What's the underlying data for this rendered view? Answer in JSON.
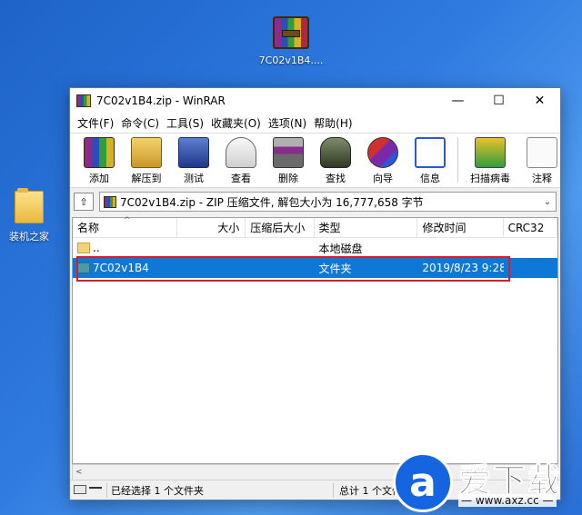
{
  "desktop": {
    "icons": [
      {
        "label": "7C02v1B4...."
      },
      {
        "label": "装机之家"
      }
    ]
  },
  "window": {
    "title": "7C02v1B4.zip - WinRAR",
    "controls": {
      "minimize": "—",
      "maximize": "☐",
      "close": "✕"
    }
  },
  "menu": [
    "文件(F)",
    "命令(C)",
    "工具(S)",
    "收藏夹(O)",
    "选项(N)",
    "帮助(H)"
  ],
  "toolbar": [
    {
      "label": "添加",
      "icon": "add-archive-icon"
    },
    {
      "label": "解压到",
      "icon": "extract-to-icon"
    },
    {
      "label": "测试",
      "icon": "test-icon"
    },
    {
      "label": "查看",
      "icon": "view-icon"
    },
    {
      "label": "删除",
      "icon": "delete-icon"
    },
    {
      "label": "查找",
      "icon": "find-icon"
    },
    {
      "label": "向导",
      "icon": "wizard-icon"
    },
    {
      "label": "信息",
      "icon": "info-icon"
    },
    {
      "label": "扫描病毒",
      "icon": "virus-scan-icon"
    },
    {
      "label": "注释",
      "icon": "comment-icon"
    }
  ],
  "address": {
    "text": "7C02v1B4.zip - ZIP 压缩文件, 解包大小为 16,777,658 字节",
    "up": "⇧",
    "dropdown": "⌄"
  },
  "columns": [
    "名称",
    "大小",
    "压缩后大小",
    "类型",
    "修改时间",
    "CRC32"
  ],
  "rows": [
    {
      "name": "..",
      "size": "",
      "packed": "",
      "type": "本地磁盘",
      "date": "",
      "crc": ""
    },
    {
      "name": "7C02v1B4",
      "size": "",
      "packed": "",
      "type": "文件夹",
      "date": "2019/8/23 9:28",
      "crc": ""
    }
  ],
  "status": {
    "left": "已经选择 1 个文件夹",
    "right": "总计 1 个文件夹"
  },
  "watermark": {
    "logo": "a",
    "text": "爱下载",
    "url": "— www.axz.cc —"
  },
  "colors": {
    "selection": "#0f78d7",
    "highlight_border": "#d81e2c",
    "desktop": "#2f7be0"
  }
}
